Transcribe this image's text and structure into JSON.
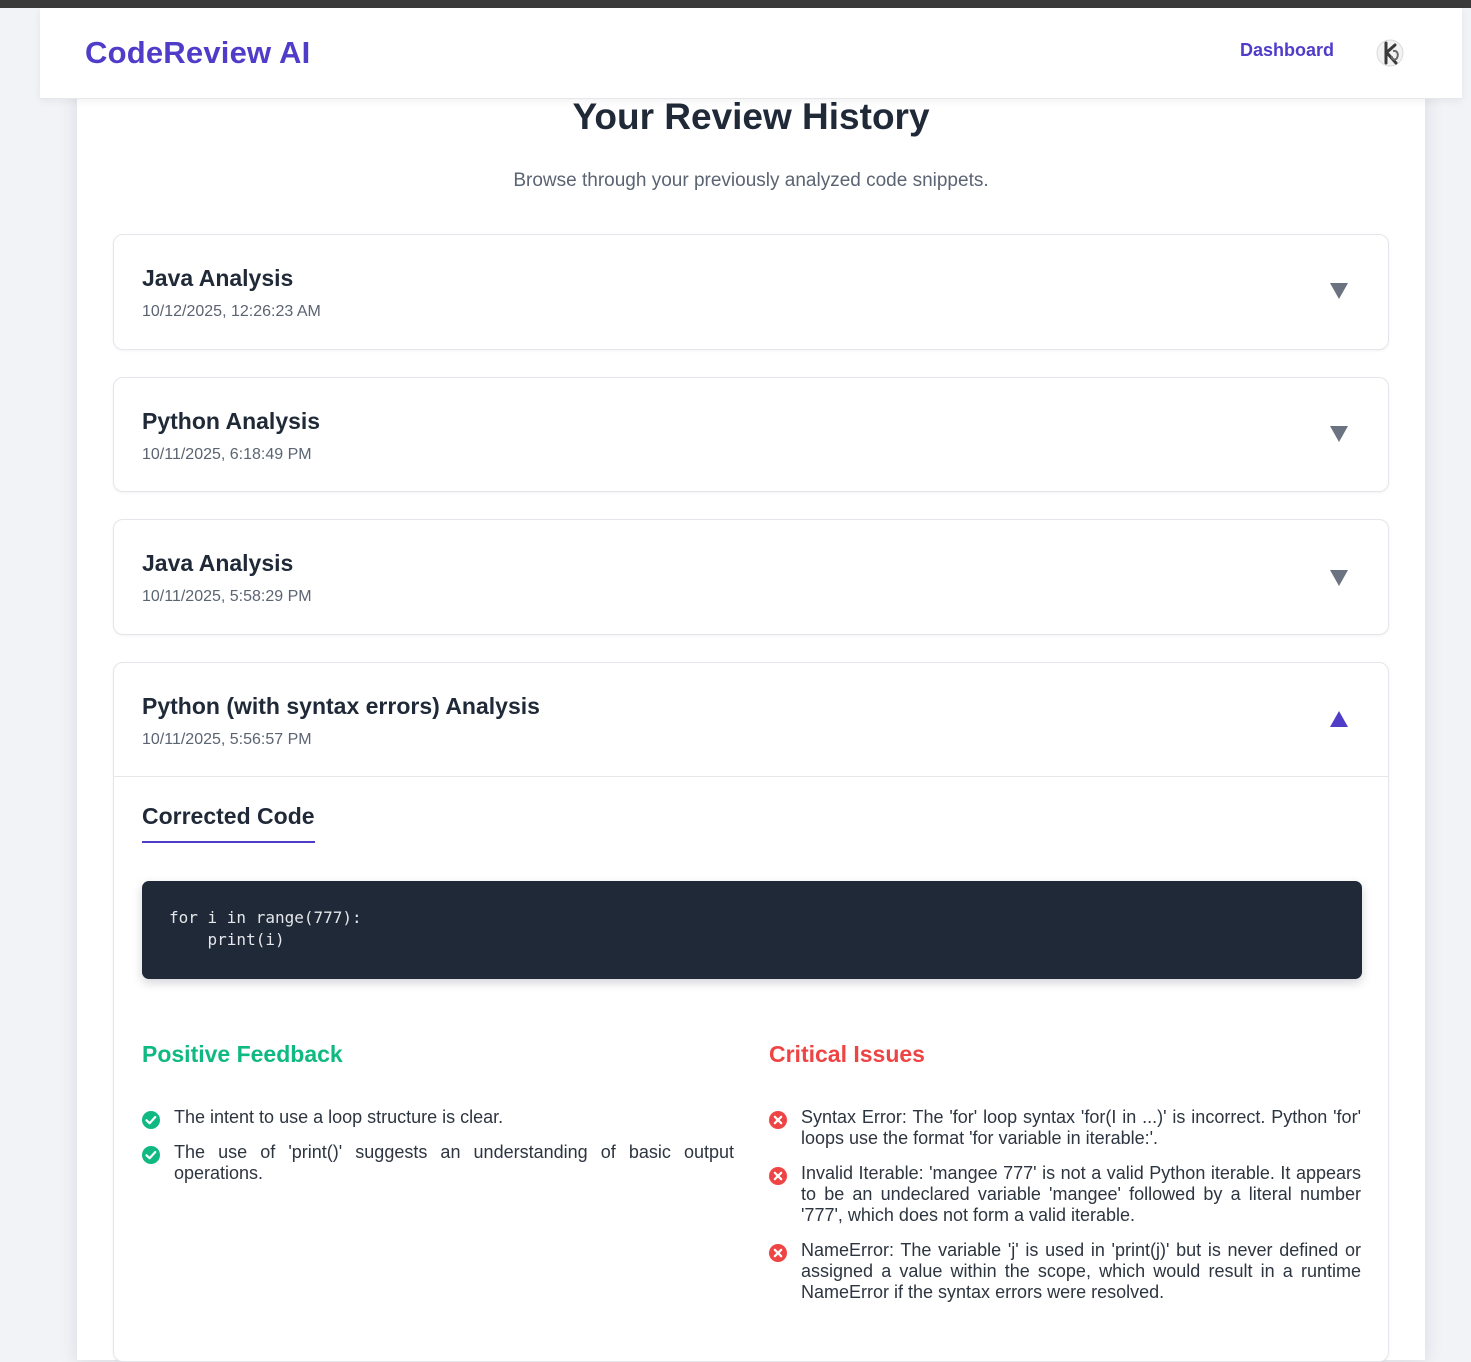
{
  "navbar": {
    "brand": "CodeReview AI",
    "links": [
      {
        "label": "Dashboard"
      }
    ],
    "avatar_icon": "user-avatar-icon"
  },
  "page": {
    "title": "Your Review History",
    "subtitle": "Browse through your previously analyzed code snippets."
  },
  "reviews": [
    {
      "title": "Java Analysis",
      "date": "10/12/2025, 12:26:23 AM",
      "expanded": false
    },
    {
      "title": "Python Analysis",
      "date": "10/11/2025, 6:18:49 PM",
      "expanded": false
    },
    {
      "title": "Java Analysis",
      "date": "10/11/2025, 5:58:29 PM",
      "expanded": false
    },
    {
      "title": "Python (with syntax errors) Analysis",
      "date": "10/11/2025, 5:56:57 PM",
      "expanded": true,
      "section_label": "Corrected Code",
      "code_lines": [
        "for i in range(777):",
        "    print(i)"
      ],
      "positive_heading": "Positive Feedback",
      "positive": [
        "The intent to use a loop structure is clear.",
        "The use of 'print()' suggests an understanding of basic output operations."
      ],
      "critical_heading": "Critical Issues",
      "critical": [
        "Syntax Error: The 'for' loop syntax 'for(I in ...)' is incorrect. Python 'for' loops use the format 'for variable in iterable:'.",
        "Invalid Iterable: 'mangee 777' is not a valid Python iterable. It appears to be an undeclared variable 'mangee' followed by a literal number '777', which does not form a valid iterable.",
        "NameError: The variable 'j' is used in 'print(j)' but is never defined or assigned a value within the scope, which would result in a runtime NameError if the syntax errors were resolved."
      ]
    }
  ],
  "colors": {
    "brand": "#4f3cc9",
    "positive": "#10b981",
    "critical": "#ef4444",
    "code_bg": "#1f2937",
    "chevron_collapsed": "#6b7280"
  },
  "icons": {
    "collapsed": "chevron-down-icon",
    "expanded": "chevron-up-icon",
    "positive": "check-circle-icon",
    "critical": "x-circle-icon"
  }
}
